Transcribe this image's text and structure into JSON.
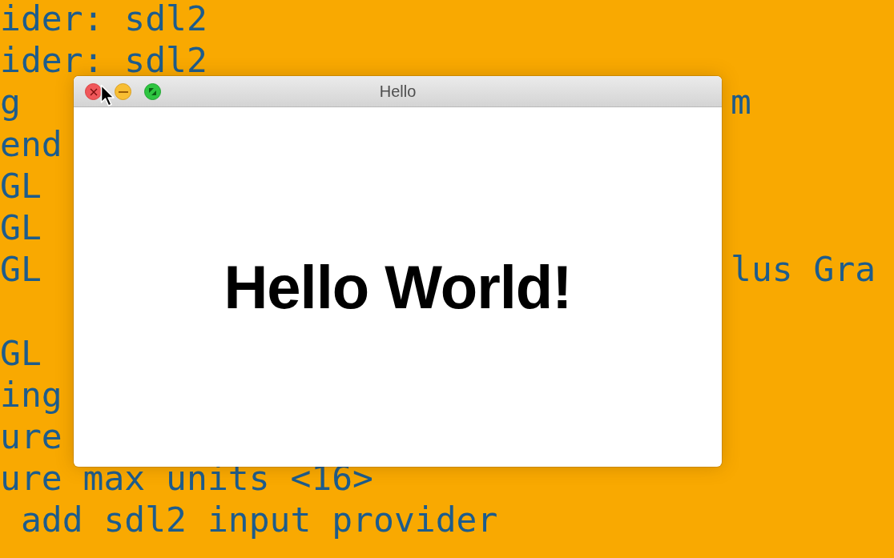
{
  "terminal": {
    "lines": [
      {
        "left": "ider: sdl2"
      },
      {
        "left": "ider: sdl2"
      },
      {
        "left": "g",
        "right": "m"
      },
      {
        "left": "end"
      },
      {
        "left": "GL"
      },
      {
        "left": "GL"
      },
      {
        "left": "GL",
        "right": "lus Gra"
      },
      {
        "left": "GL",
        "gap_before": true
      },
      {
        "left": "ing"
      },
      {
        "left": "ure"
      },
      {
        "left": "ure max units <16>"
      },
      {
        "left": " add sdl2 input provider"
      }
    ]
  },
  "window": {
    "title": "Hello",
    "buttons": [
      {
        "kind": "close"
      },
      {
        "kind": "minimize"
      },
      {
        "kind": "zoom"
      }
    ],
    "heading": "Hello World!"
  }
}
